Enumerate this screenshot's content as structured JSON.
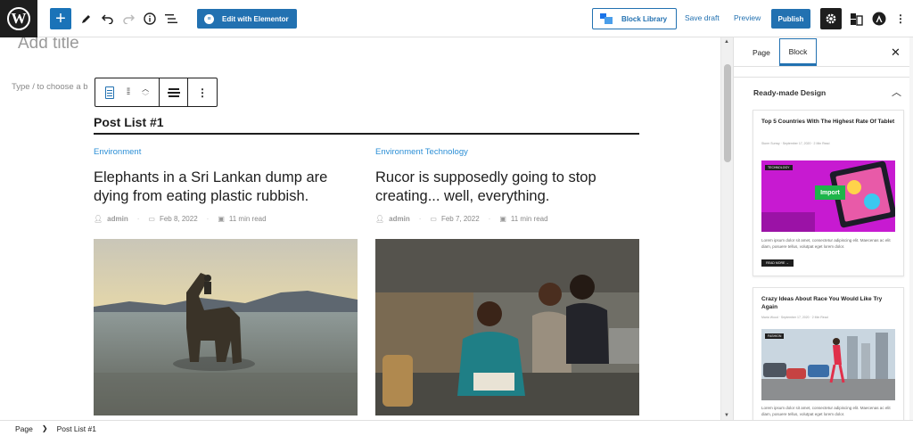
{
  "toolbar": {
    "logo": "W",
    "elementor_label": "Edit with Elementor",
    "block_library_label": "Block Library",
    "save_draft_label": "Save draft",
    "preview_label": "Preview",
    "publish_label": "Publish",
    "accent_color": "#2271b1"
  },
  "editor": {
    "title_placeholder": "Add title",
    "block_hint": "Type / to choose a b",
    "post_list_title": "Post List #1",
    "posts": [
      {
        "category": "Environment",
        "title": "Elephants in a Sri Lankan dump are dying from eating plastic rubbish.",
        "author": "admin",
        "date": "Feb 8, 2022",
        "read_time": "11 min read"
      },
      {
        "category": "Environment Technology",
        "title": "Rucor is supposedly going to stop creating... well, everything.",
        "author": "admin",
        "date": "Feb 7, 2022",
        "read_time": "11 min read"
      }
    ]
  },
  "sidebar": {
    "tabs": [
      "Page",
      "Block"
    ],
    "active_tab": "Block",
    "panel_title": "Ready-made Design",
    "designs": [
      {
        "title": "Top 5 Countries With The Highest Rate Of Tablet",
        "meta": "Storm Surray  ·  September 17, 2020  ·  2 Min Read",
        "badge": "TECHNOLOGY",
        "import_label": "Import",
        "excerpt": "Lorem ipsum dolor sit amet, consectetur adipiscing elit. Maecenas ac elit diam, posuere tellus, volutpat eget lorem dolor.",
        "read_more": "READ MORE →"
      },
      {
        "title": "Crazy Ideas About Race You Would Like Try Again",
        "meta": "Maria Wood  ·  September 17, 2020  ·  2 Min Read",
        "badge": "FASHION",
        "excerpt": "Lorem ipsum dolor sit amet, consectetur adipiscing elit. Maecenas ac elit diam, posuere tellus, volutpat eget lorem dolor."
      }
    ]
  },
  "statusbar": {
    "breadcrumb": [
      "Page",
      "Post List #1"
    ]
  }
}
